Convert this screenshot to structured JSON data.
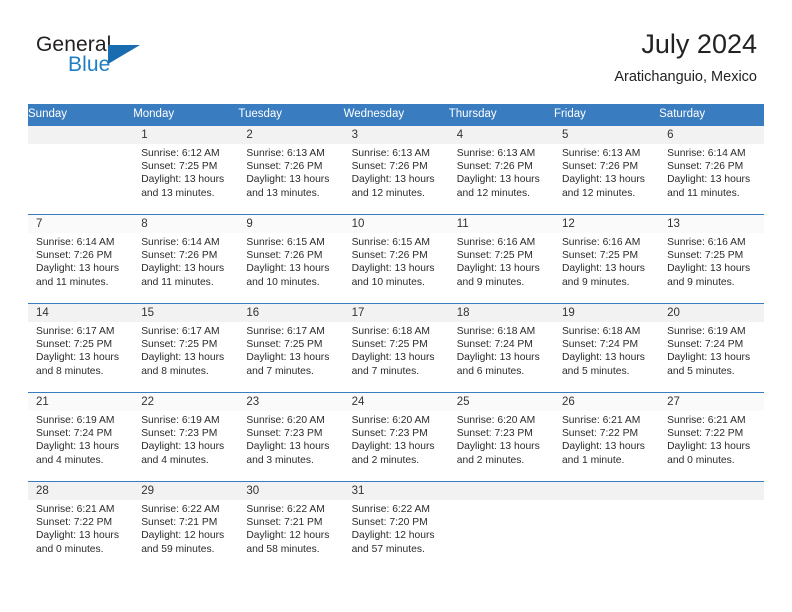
{
  "brand": {
    "word1": "General",
    "word2": "Blue",
    "accent_color": "#1f7ec4",
    "triangle_icon": "triangle-icon"
  },
  "header": {
    "title": "July 2024",
    "subtitle": "Aratichanguio, Mexico"
  },
  "calendar": {
    "header_bg": "#3a7cc0",
    "weekday_headers": [
      "Sunday",
      "Monday",
      "Tuesday",
      "Wednesday",
      "Thursday",
      "Friday",
      "Saturday"
    ],
    "weeks": [
      [
        {
          "day": "",
          "sunrise": "",
          "sunset": "",
          "daylight_line1": "",
          "daylight_line2": ""
        },
        {
          "day": "1",
          "sunrise": "Sunrise: 6:12 AM",
          "sunset": "Sunset: 7:25 PM",
          "daylight_line1": "Daylight: 13 hours",
          "daylight_line2": "and 13 minutes."
        },
        {
          "day": "2",
          "sunrise": "Sunrise: 6:13 AM",
          "sunset": "Sunset: 7:26 PM",
          "daylight_line1": "Daylight: 13 hours",
          "daylight_line2": "and 13 minutes."
        },
        {
          "day": "3",
          "sunrise": "Sunrise: 6:13 AM",
          "sunset": "Sunset: 7:26 PM",
          "daylight_line1": "Daylight: 13 hours",
          "daylight_line2": "and 12 minutes."
        },
        {
          "day": "4",
          "sunrise": "Sunrise: 6:13 AM",
          "sunset": "Sunset: 7:26 PM",
          "daylight_line1": "Daylight: 13 hours",
          "daylight_line2": "and 12 minutes."
        },
        {
          "day": "5",
          "sunrise": "Sunrise: 6:13 AM",
          "sunset": "Sunset: 7:26 PM",
          "daylight_line1": "Daylight: 13 hours",
          "daylight_line2": "and 12 minutes."
        },
        {
          "day": "6",
          "sunrise": "Sunrise: 6:14 AM",
          "sunset": "Sunset: 7:26 PM",
          "daylight_line1": "Daylight: 13 hours",
          "daylight_line2": "and 11 minutes."
        }
      ],
      [
        {
          "day": "7",
          "sunrise": "Sunrise: 6:14 AM",
          "sunset": "Sunset: 7:26 PM",
          "daylight_line1": "Daylight: 13 hours",
          "daylight_line2": "and 11 minutes."
        },
        {
          "day": "8",
          "sunrise": "Sunrise: 6:14 AM",
          "sunset": "Sunset: 7:26 PM",
          "daylight_line1": "Daylight: 13 hours",
          "daylight_line2": "and 11 minutes."
        },
        {
          "day": "9",
          "sunrise": "Sunrise: 6:15 AM",
          "sunset": "Sunset: 7:26 PM",
          "daylight_line1": "Daylight: 13 hours",
          "daylight_line2": "and 10 minutes."
        },
        {
          "day": "10",
          "sunrise": "Sunrise: 6:15 AM",
          "sunset": "Sunset: 7:26 PM",
          "daylight_line1": "Daylight: 13 hours",
          "daylight_line2": "and 10 minutes."
        },
        {
          "day": "11",
          "sunrise": "Sunrise: 6:16 AM",
          "sunset": "Sunset: 7:25 PM",
          "daylight_line1": "Daylight: 13 hours",
          "daylight_line2": "and 9 minutes."
        },
        {
          "day": "12",
          "sunrise": "Sunrise: 6:16 AM",
          "sunset": "Sunset: 7:25 PM",
          "daylight_line1": "Daylight: 13 hours",
          "daylight_line2": "and 9 minutes."
        },
        {
          "day": "13",
          "sunrise": "Sunrise: 6:16 AM",
          "sunset": "Sunset: 7:25 PM",
          "daylight_line1": "Daylight: 13 hours",
          "daylight_line2": "and 9 minutes."
        }
      ],
      [
        {
          "day": "14",
          "sunrise": "Sunrise: 6:17 AM",
          "sunset": "Sunset: 7:25 PM",
          "daylight_line1": "Daylight: 13 hours",
          "daylight_line2": "and 8 minutes."
        },
        {
          "day": "15",
          "sunrise": "Sunrise: 6:17 AM",
          "sunset": "Sunset: 7:25 PM",
          "daylight_line1": "Daylight: 13 hours",
          "daylight_line2": "and 8 minutes."
        },
        {
          "day": "16",
          "sunrise": "Sunrise: 6:17 AM",
          "sunset": "Sunset: 7:25 PM",
          "daylight_line1": "Daylight: 13 hours",
          "daylight_line2": "and 7 minutes."
        },
        {
          "day": "17",
          "sunrise": "Sunrise: 6:18 AM",
          "sunset": "Sunset: 7:25 PM",
          "daylight_line1": "Daylight: 13 hours",
          "daylight_line2": "and 7 minutes."
        },
        {
          "day": "18",
          "sunrise": "Sunrise: 6:18 AM",
          "sunset": "Sunset: 7:24 PM",
          "daylight_line1": "Daylight: 13 hours",
          "daylight_line2": "and 6 minutes."
        },
        {
          "day": "19",
          "sunrise": "Sunrise: 6:18 AM",
          "sunset": "Sunset: 7:24 PM",
          "daylight_line1": "Daylight: 13 hours",
          "daylight_line2": "and 5 minutes."
        },
        {
          "day": "20",
          "sunrise": "Sunrise: 6:19 AM",
          "sunset": "Sunset: 7:24 PM",
          "daylight_line1": "Daylight: 13 hours",
          "daylight_line2": "and 5 minutes."
        }
      ],
      [
        {
          "day": "21",
          "sunrise": "Sunrise: 6:19 AM",
          "sunset": "Sunset: 7:24 PM",
          "daylight_line1": "Daylight: 13 hours",
          "daylight_line2": "and 4 minutes."
        },
        {
          "day": "22",
          "sunrise": "Sunrise: 6:19 AM",
          "sunset": "Sunset: 7:23 PM",
          "daylight_line1": "Daylight: 13 hours",
          "daylight_line2": "and 4 minutes."
        },
        {
          "day": "23",
          "sunrise": "Sunrise: 6:20 AM",
          "sunset": "Sunset: 7:23 PM",
          "daylight_line1": "Daylight: 13 hours",
          "daylight_line2": "and 3 minutes."
        },
        {
          "day": "24",
          "sunrise": "Sunrise: 6:20 AM",
          "sunset": "Sunset: 7:23 PM",
          "daylight_line1": "Daylight: 13 hours",
          "daylight_line2": "and 2 minutes."
        },
        {
          "day": "25",
          "sunrise": "Sunrise: 6:20 AM",
          "sunset": "Sunset: 7:23 PM",
          "daylight_line1": "Daylight: 13 hours",
          "daylight_line2": "and 2 minutes."
        },
        {
          "day": "26",
          "sunrise": "Sunrise: 6:21 AM",
          "sunset": "Sunset: 7:22 PM",
          "daylight_line1": "Daylight: 13 hours",
          "daylight_line2": "and 1 minute."
        },
        {
          "day": "27",
          "sunrise": "Sunrise: 6:21 AM",
          "sunset": "Sunset: 7:22 PM",
          "daylight_line1": "Daylight: 13 hours",
          "daylight_line2": "and 0 minutes."
        }
      ],
      [
        {
          "day": "28",
          "sunrise": "Sunrise: 6:21 AM",
          "sunset": "Sunset: 7:22 PM",
          "daylight_line1": "Daylight: 13 hours",
          "daylight_line2": "and 0 minutes."
        },
        {
          "day": "29",
          "sunrise": "Sunrise: 6:22 AM",
          "sunset": "Sunset: 7:21 PM",
          "daylight_line1": "Daylight: 12 hours",
          "daylight_line2": "and 59 minutes."
        },
        {
          "day": "30",
          "sunrise": "Sunrise: 6:22 AM",
          "sunset": "Sunset: 7:21 PM",
          "daylight_line1": "Daylight: 12 hours",
          "daylight_line2": "and 58 minutes."
        },
        {
          "day": "31",
          "sunrise": "Sunrise: 6:22 AM",
          "sunset": "Sunset: 7:20 PM",
          "daylight_line1": "Daylight: 12 hours",
          "daylight_line2": "and 57 minutes."
        },
        {
          "day": "",
          "sunrise": "",
          "sunset": "",
          "daylight_line1": "",
          "daylight_line2": ""
        },
        {
          "day": "",
          "sunrise": "",
          "sunset": "",
          "daylight_line1": "",
          "daylight_line2": ""
        },
        {
          "day": "",
          "sunrise": "",
          "sunset": "",
          "daylight_line1": "",
          "daylight_line2": ""
        }
      ]
    ]
  }
}
